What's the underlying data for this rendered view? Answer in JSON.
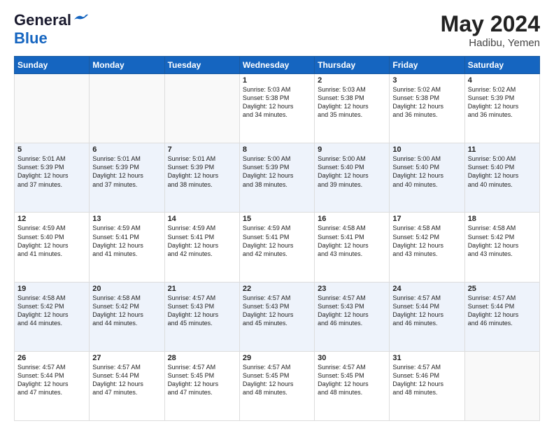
{
  "header": {
    "logo_line1_general": "General",
    "logo_line2_blue": "Blue",
    "month_year": "May 2024",
    "location": "Hadibu, Yemen"
  },
  "days_of_week": [
    "Sunday",
    "Monday",
    "Tuesday",
    "Wednesday",
    "Thursday",
    "Friday",
    "Saturday"
  ],
  "weeks": [
    [
      {
        "day": "",
        "content": ""
      },
      {
        "day": "",
        "content": ""
      },
      {
        "day": "",
        "content": ""
      },
      {
        "day": "1",
        "content": "Sunrise: 5:03 AM\nSunset: 5:38 PM\nDaylight: 12 hours\nand 34 minutes."
      },
      {
        "day": "2",
        "content": "Sunrise: 5:03 AM\nSunset: 5:38 PM\nDaylight: 12 hours\nand 35 minutes."
      },
      {
        "day": "3",
        "content": "Sunrise: 5:02 AM\nSunset: 5:38 PM\nDaylight: 12 hours\nand 36 minutes."
      },
      {
        "day": "4",
        "content": "Sunrise: 5:02 AM\nSunset: 5:39 PM\nDaylight: 12 hours\nand 36 minutes."
      }
    ],
    [
      {
        "day": "5",
        "content": "Sunrise: 5:01 AM\nSunset: 5:39 PM\nDaylight: 12 hours\nand 37 minutes."
      },
      {
        "day": "6",
        "content": "Sunrise: 5:01 AM\nSunset: 5:39 PM\nDaylight: 12 hours\nand 37 minutes."
      },
      {
        "day": "7",
        "content": "Sunrise: 5:01 AM\nSunset: 5:39 PM\nDaylight: 12 hours\nand 38 minutes."
      },
      {
        "day": "8",
        "content": "Sunrise: 5:00 AM\nSunset: 5:39 PM\nDaylight: 12 hours\nand 38 minutes."
      },
      {
        "day": "9",
        "content": "Sunrise: 5:00 AM\nSunset: 5:40 PM\nDaylight: 12 hours\nand 39 minutes."
      },
      {
        "day": "10",
        "content": "Sunrise: 5:00 AM\nSunset: 5:40 PM\nDaylight: 12 hours\nand 40 minutes."
      },
      {
        "day": "11",
        "content": "Sunrise: 5:00 AM\nSunset: 5:40 PM\nDaylight: 12 hours\nand 40 minutes."
      }
    ],
    [
      {
        "day": "12",
        "content": "Sunrise: 4:59 AM\nSunset: 5:40 PM\nDaylight: 12 hours\nand 41 minutes."
      },
      {
        "day": "13",
        "content": "Sunrise: 4:59 AM\nSunset: 5:41 PM\nDaylight: 12 hours\nand 41 minutes."
      },
      {
        "day": "14",
        "content": "Sunrise: 4:59 AM\nSunset: 5:41 PM\nDaylight: 12 hours\nand 42 minutes."
      },
      {
        "day": "15",
        "content": "Sunrise: 4:59 AM\nSunset: 5:41 PM\nDaylight: 12 hours\nand 42 minutes."
      },
      {
        "day": "16",
        "content": "Sunrise: 4:58 AM\nSunset: 5:41 PM\nDaylight: 12 hours\nand 43 minutes."
      },
      {
        "day": "17",
        "content": "Sunrise: 4:58 AM\nSunset: 5:42 PM\nDaylight: 12 hours\nand 43 minutes."
      },
      {
        "day": "18",
        "content": "Sunrise: 4:58 AM\nSunset: 5:42 PM\nDaylight: 12 hours\nand 43 minutes."
      }
    ],
    [
      {
        "day": "19",
        "content": "Sunrise: 4:58 AM\nSunset: 5:42 PM\nDaylight: 12 hours\nand 44 minutes."
      },
      {
        "day": "20",
        "content": "Sunrise: 4:58 AM\nSunset: 5:42 PM\nDaylight: 12 hours\nand 44 minutes."
      },
      {
        "day": "21",
        "content": "Sunrise: 4:57 AM\nSunset: 5:43 PM\nDaylight: 12 hours\nand 45 minutes."
      },
      {
        "day": "22",
        "content": "Sunrise: 4:57 AM\nSunset: 5:43 PM\nDaylight: 12 hours\nand 45 minutes."
      },
      {
        "day": "23",
        "content": "Sunrise: 4:57 AM\nSunset: 5:43 PM\nDaylight: 12 hours\nand 46 minutes."
      },
      {
        "day": "24",
        "content": "Sunrise: 4:57 AM\nSunset: 5:44 PM\nDaylight: 12 hours\nand 46 minutes."
      },
      {
        "day": "25",
        "content": "Sunrise: 4:57 AM\nSunset: 5:44 PM\nDaylight: 12 hours\nand 46 minutes."
      }
    ],
    [
      {
        "day": "26",
        "content": "Sunrise: 4:57 AM\nSunset: 5:44 PM\nDaylight: 12 hours\nand 47 minutes."
      },
      {
        "day": "27",
        "content": "Sunrise: 4:57 AM\nSunset: 5:44 PM\nDaylight: 12 hours\nand 47 minutes."
      },
      {
        "day": "28",
        "content": "Sunrise: 4:57 AM\nSunset: 5:45 PM\nDaylight: 12 hours\nand 47 minutes."
      },
      {
        "day": "29",
        "content": "Sunrise: 4:57 AM\nSunset: 5:45 PM\nDaylight: 12 hours\nand 48 minutes."
      },
      {
        "day": "30",
        "content": "Sunrise: 4:57 AM\nSunset: 5:45 PM\nDaylight: 12 hours\nand 48 minutes."
      },
      {
        "day": "31",
        "content": "Sunrise: 4:57 AM\nSunset: 5:46 PM\nDaylight: 12 hours\nand 48 minutes."
      },
      {
        "day": "",
        "content": ""
      }
    ]
  ]
}
